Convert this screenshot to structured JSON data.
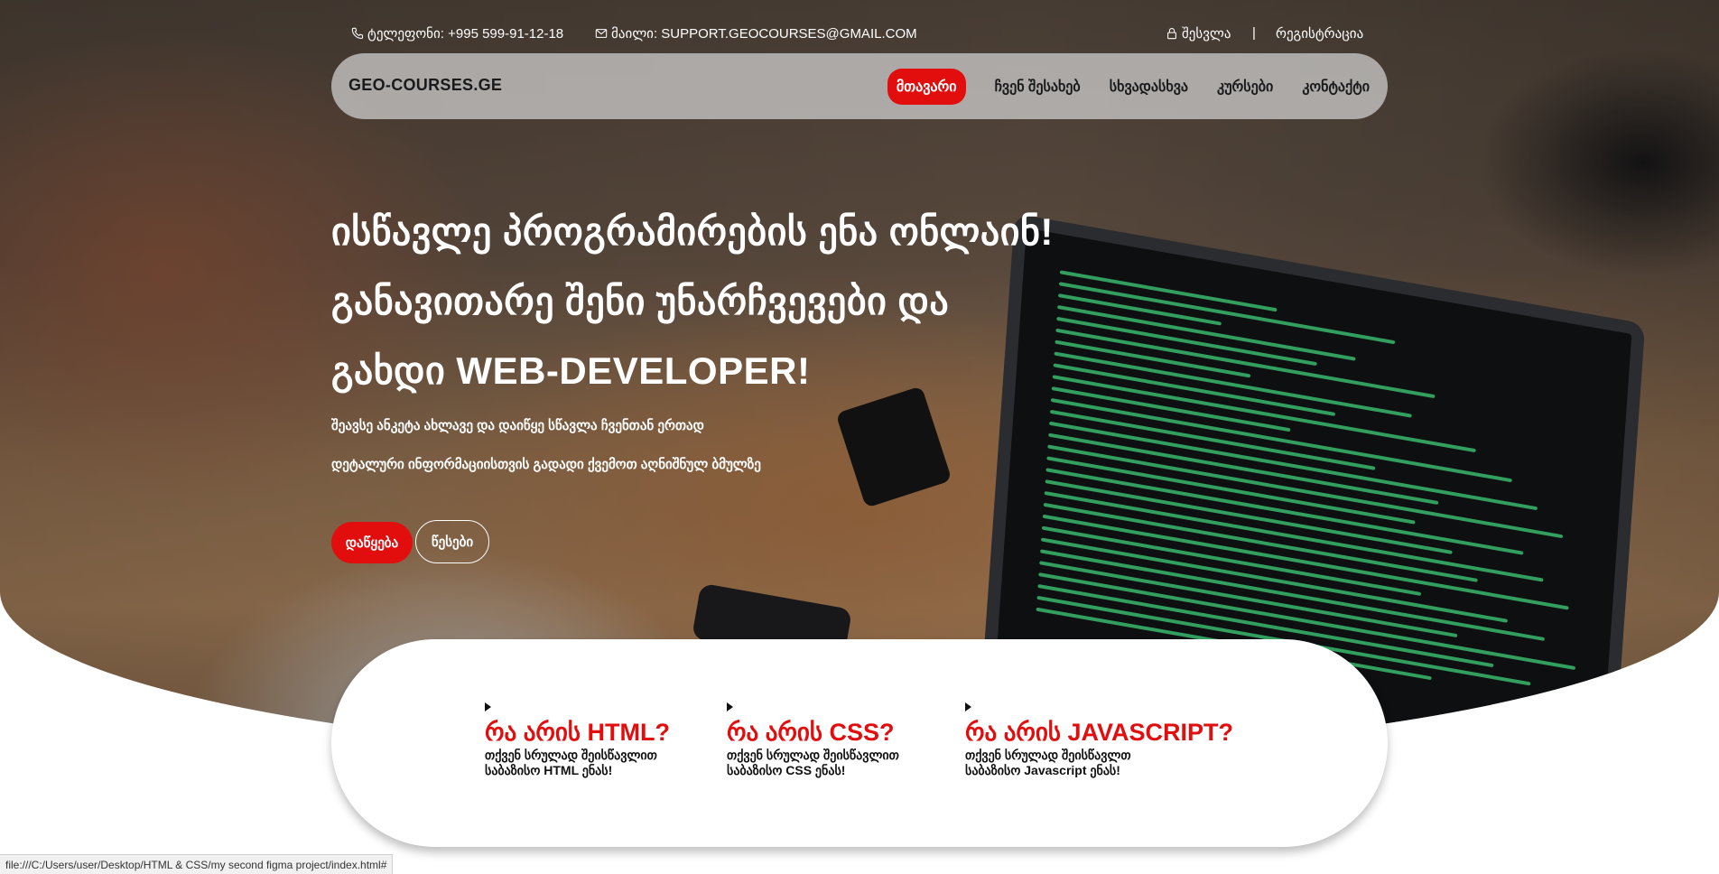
{
  "contact": {
    "phone_text": "ტელეფონი: +995 599-91-12-18",
    "email_text": "მაილი: SUPPORT.GEOCOURSES@GMAIL.COM",
    "login_label": "შესვლა",
    "separator": "|",
    "register_label": "რეგისტრაცია"
  },
  "nav": {
    "brand": "GEO-COURSES.GE",
    "links": [
      {
        "label": "მთავარი",
        "active": true
      },
      {
        "label": "ჩვენ შესახებ"
      },
      {
        "label": "სხვადასხვა"
      },
      {
        "label": "კურსები"
      },
      {
        "label": "კონტაქტი"
      }
    ]
  },
  "hero": {
    "headline_lines": [
      "ისწავლე პროგრამირების ენა ონლაინ!",
      "განავითარე შენი უნარჩვევები და",
      "გახდი WEB-DEVELOPER!"
    ],
    "sub_lines": [
      "შეავსე ანკეტა ახლავე და დაიწყე სწავლა ჩვენთან ერთად",
      "დეტალური ინფორმაციისთვის გადადი ქვემოთ აღნიშნულ ბმულზე"
    ],
    "start_button": "დაწყება",
    "rules_button": "წესები"
  },
  "topics": [
    {
      "title": "რა არის HTML?",
      "description": "თქვენ სრულად შეისწავლით საბაზისო HTML ენას!"
    },
    {
      "title": "რა არის CSS?",
      "description": "თქვენ სრულად შეისწავლით საბაზისო CSS ენას!"
    },
    {
      "title": "რა არის JAVASCRIPT?",
      "description": "თქვენ სრულად შეისწავლთ საბაზისო Javascript ენას!"
    }
  ],
  "status_bar": {
    "url": "file:///C:/Users/user/Desktop/HTML & CSS/my second figma project/index.html#"
  },
  "colors": {
    "accent": "#e20e0e",
    "nav_bg": "#cdcdcd",
    "card_bg": "#ffffff"
  },
  "icons": {
    "phone": "phone-icon",
    "email": "mail-icon",
    "login": "lock-icon"
  }
}
